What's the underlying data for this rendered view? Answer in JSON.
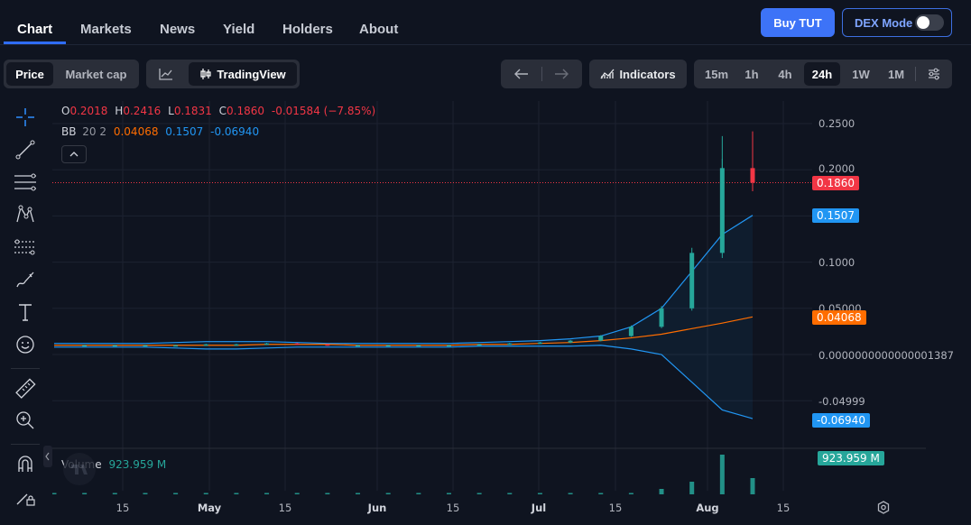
{
  "nav": {
    "tabs": [
      {
        "label": "Chart",
        "active": true
      },
      {
        "label": "Markets",
        "active": false
      },
      {
        "label": "News",
        "active": false
      },
      {
        "label": "Yield",
        "active": false
      },
      {
        "label": "Holders",
        "active": false
      },
      {
        "label": "About",
        "active": false
      }
    ],
    "buy_label": "Buy TUT",
    "dex_label": "DEX Mode",
    "dex_enabled": false
  },
  "toolbar": {
    "price_label": "Price",
    "marketcap_label": "Market cap",
    "tradingview_label": "TradingView",
    "indicators_label": "Indicators",
    "timeframes": [
      "15m",
      "1h",
      "4h",
      "24h",
      "1W",
      "1M"
    ],
    "active_timeframe": "24h"
  },
  "left_tools": [
    "crosshair-icon",
    "trendline-icon",
    "fib-lines-icon",
    "pattern-icon",
    "forecast-icon",
    "brush-icon",
    "text-icon",
    "emoji-icon",
    "ruler-icon",
    "zoom-in-icon",
    "magnet-icon",
    "lock-drawings-icon"
  ],
  "legend": {
    "o_label": "O",
    "o_value": "0.2018",
    "h_label": "H",
    "h_value": "0.2416",
    "l_label": "L",
    "l_value": "0.1831",
    "c_label": "C",
    "c_value": "0.1860",
    "change": "-0.01584 (−7.85%)",
    "bb_label": "BB",
    "bb_params": "20 2",
    "bb_basis": "0.04068",
    "bb_upper": "0.1507",
    "bb_lower": "-0.06940"
  },
  "volume": {
    "label": "Volume",
    "value": "923.959 M",
    "tag": "923.959 M"
  },
  "price_tags": {
    "close": "0.1860",
    "bb_upper": "0.1507",
    "bb_basis": "0.04068",
    "bb_lower": "-0.06940"
  },
  "colors": {
    "up": "#26a69a",
    "down": "#f23645",
    "bb_basis": "#ff6d00",
    "bb_bands": "#2196f3",
    "accent": "#3d73f7"
  },
  "chart_data": {
    "type": "line",
    "y_axis_labels": [
      "0.2500",
      "0.2000",
      "0.1000",
      "0.05000",
      "0.0000000000000001387",
      "-0.04999"
    ],
    "x_axis_labels": [
      "15",
      "May",
      "15",
      "Jun",
      "15",
      "Jul",
      "15",
      "Aug",
      "15"
    ],
    "x_axis_bold": [
      "May",
      "Jun",
      "Jul",
      "Aug"
    ],
    "ylim": [
      -0.08,
      0.26
    ],
    "series": [
      {
        "name": "Close",
        "values": [
          0.01,
          0.01,
          0.01,
          0.01,
          0.01,
          0.011,
          0.011,
          0.012,
          0.011,
          0.01,
          0.01,
          0.01,
          0.01,
          0.01,
          0.011,
          0.012,
          0.013,
          0.015,
          0.02,
          0.03,
          0.05,
          0.11,
          0.2018,
          0.186
        ]
      },
      {
        "name": "BB basis",
        "values": [
          0.01,
          0.01,
          0.01,
          0.01,
          0.01,
          0.01,
          0.01,
          0.011,
          0.011,
          0.011,
          0.01,
          0.01,
          0.01,
          0.01,
          0.011,
          0.011,
          0.012,
          0.013,
          0.015,
          0.018,
          0.022,
          0.028,
          0.034,
          0.04068
        ]
      },
      {
        "name": "BB upper",
        "values": [
          0.012,
          0.012,
          0.012,
          0.012,
          0.013,
          0.014,
          0.014,
          0.014,
          0.013,
          0.012,
          0.012,
          0.012,
          0.012,
          0.012,
          0.013,
          0.014,
          0.015,
          0.017,
          0.02,
          0.03,
          0.05,
          0.09,
          0.13,
          0.1507
        ]
      },
      {
        "name": "BB lower",
        "values": [
          0.008,
          0.008,
          0.008,
          0.008,
          0.007,
          0.006,
          0.006,
          0.007,
          0.008,
          0.008,
          0.008,
          0.008,
          0.008,
          0.008,
          0.009,
          0.009,
          0.009,
          0.009,
          0.01,
          0.006,
          0.0,
          -0.03,
          -0.06,
          -0.0694
        ]
      }
    ]
  }
}
